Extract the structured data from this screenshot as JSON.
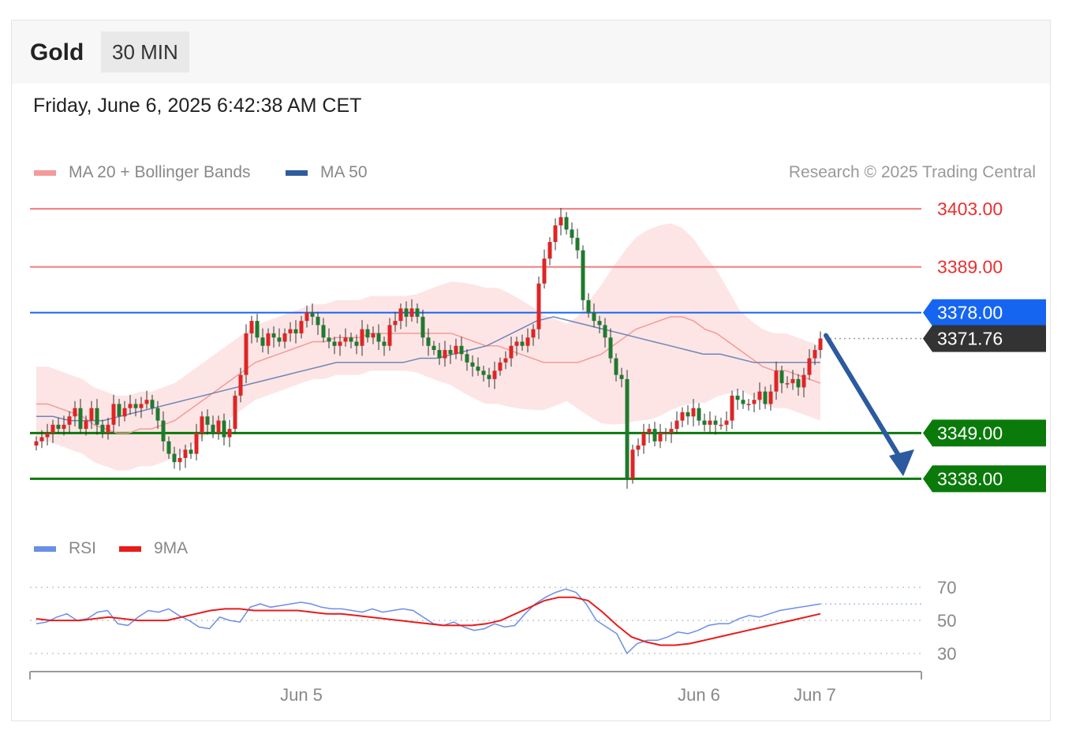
{
  "header": {
    "asset": "Gold",
    "timeframe": "30 MIN"
  },
  "timestamp": "Friday, June 6, 2025 6:42:38 AM CET",
  "legend_main": [
    {
      "label": "MA 20 + Bollinger Bands",
      "color": "#f59a9a"
    },
    {
      "label": "MA 50",
      "color": "#2f5c9e"
    }
  ],
  "legend_rsi": [
    {
      "label": "RSI",
      "color": "#6b8ee8"
    },
    {
      "label": "9MA",
      "color": "#e81b1b"
    }
  ],
  "credit": "Research © 2025 Trading Central",
  "colors": {
    "resistance": "#f07a7a",
    "pivot": "#1565f0",
    "support": "#0a7a0a",
    "last": "#333333",
    "arrow": "#2c5aa0",
    "band": "#fde0e0",
    "bull": "#e02424",
    "bear": "#1f7a2e"
  },
  "chart_data": [
    {
      "type": "candlestick",
      "title": "Gold",
      "timeframe": "30 MIN",
      "ylim": [
        3328,
        3410
      ],
      "levels": [
        {
          "value": 3403.0,
          "label": "3403.00",
          "kind": "resistance"
        },
        {
          "value": 3389.0,
          "label": "3389.00",
          "kind": "resistance"
        },
        {
          "value": 3378.0,
          "label": "3378.00",
          "kind": "pivot"
        },
        {
          "value": 3371.76,
          "label": "3371.76",
          "kind": "last"
        },
        {
          "value": 3349.0,
          "label": "3349.00",
          "kind": "support"
        },
        {
          "value": 3338.0,
          "label": "3338.00",
          "kind": "support"
        }
      ],
      "x_ticks": [
        "Jun 5",
        "Jun 6",
        "Jun 7"
      ],
      "x_tick_index": [
        48,
        120,
        141
      ],
      "forecast_arrow": {
        "from_index": 143,
        "from_value": 3372.5,
        "to_index": 157,
        "to_value": 3338.6
      },
      "series": [
        {
          "kind": "close",
          "values": [
            3347,
            3348,
            3349,
            3351,
            3350,
            3351,
            3353,
            3355,
            3350,
            3352,
            3355,
            3351,
            3349,
            3351,
            3356,
            3353,
            3355,
            3356,
            3355,
            3356,
            3357,
            3355,
            3352,
            3347,
            3344,
            3342,
            3343,
            3345,
            3344,
            3349,
            3353,
            3351,
            3349,
            3352,
            3348,
            3350,
            3358,
            3363,
            3373,
            3376,
            3372,
            3370,
            3373,
            3372,
            3371,
            3373,
            3374,
            3373,
            3376,
            3378,
            3377,
            3375,
            3372,
            3371,
            3370,
            3371,
            3372,
            3371,
            3370,
            3374,
            3372,
            3373,
            3371,
            3370,
            3375,
            3376,
            3379,
            3377,
            3379,
            3377,
            3372,
            3370,
            3369,
            3367,
            3369,
            3368,
            3370,
            3368,
            3366,
            3365,
            3364,
            3363,
            3362,
            3364,
            3366,
            3367,
            3370,
            3371,
            3370,
            3372,
            3374,
            3385,
            3391,
            3395,
            3399,
            3401,
            3398,
            3396,
            3393,
            3381,
            3378,
            3376,
            3375,
            3372,
            3367,
            3363,
            3362,
            3338,
            3345,
            3346,
            3349,
            3350,
            3347,
            3349,
            3349,
            3350,
            3352,
            3354,
            3353,
            3355,
            3352,
            3351,
            3352,
            3351,
            3351,
            3352,
            3358,
            3357,
            3356,
            3356,
            3357,
            3359,
            3356,
            3359,
            3364,
            3361,
            3361,
            3362,
            3360,
            3363,
            3367,
            3369,
            3371.76
          ]
        },
        {
          "kind": "ma20",
          "values": [
            3356,
            3356,
            3355,
            3354,
            3353,
            3351,
            3350,
            3349,
            3349,
            3350,
            3350,
            3351,
            3352,
            3354,
            3356,
            3358,
            3360,
            3362,
            3364,
            3366,
            3367,
            3368,
            3369,
            3370,
            3371,
            3371,
            3372,
            3372,
            3372,
            3373,
            3373,
            3373,
            3373,
            3373,
            3373,
            3373,
            3373,
            3372,
            3371,
            3370,
            3370,
            3369,
            3368,
            3367,
            3366,
            3366,
            3366,
            3366,
            3367,
            3368,
            3370,
            3372,
            3374,
            3375,
            3376,
            3377,
            3377,
            3376,
            3374,
            3373,
            3371,
            3369,
            3367,
            3365,
            3364,
            3364,
            3363,
            3362,
            3361
          ]
        },
        {
          "kind": "ma50",
          "values": [
            3353,
            3353,
            3352,
            3352,
            3352,
            3353,
            3354,
            3355,
            3356,
            3357,
            3358,
            3359,
            3360,
            3361,
            3362,
            3363,
            3364,
            3365,
            3366,
            3366,
            3366,
            3366,
            3366,
            3367,
            3367,
            3368,
            3369,
            3370,
            3372,
            3374,
            3376,
            3377,
            3376,
            3375,
            3374,
            3373,
            3372,
            3371,
            3370,
            3369,
            3368,
            3368,
            3367,
            3366,
            3366,
            3366,
            3366,
            3366
          ]
        },
        {
          "kind": "rsi",
          "values": [
            48,
            49,
            52,
            54,
            50,
            51,
            55,
            56,
            48,
            47,
            52,
            56,
            55,
            57,
            53,
            50,
            46,
            45,
            52,
            50,
            49,
            58,
            60,
            58,
            59,
            60,
            61,
            60,
            58,
            57,
            57,
            56,
            55,
            57,
            55,
            56,
            57,
            56,
            52,
            48,
            47,
            49,
            46,
            44,
            45,
            48,
            46,
            47,
            54,
            60,
            64,
            67,
            69,
            67,
            60,
            50,
            46,
            42,
            30,
            36,
            38,
            38,
            40,
            43,
            42,
            44,
            47,
            48,
            48,
            51,
            53,
            52,
            54,
            56,
            57,
            58,
            59,
            60
          ]
        },
        {
          "kind": "rsi_9ma",
          "values": [
            51,
            50,
            50,
            50,
            51,
            52,
            51,
            50,
            50,
            50,
            52,
            54,
            56,
            57,
            57,
            56,
            56,
            56,
            56,
            55,
            54,
            54,
            53,
            52,
            51,
            50,
            49,
            48,
            47,
            47,
            47,
            48,
            50,
            54,
            58,
            62,
            64,
            64,
            62,
            55,
            47,
            40,
            37,
            35,
            35,
            36,
            38,
            40,
            42,
            44,
            46,
            48,
            50,
            52,
            54
          ]
        }
      ],
      "rsi_axis": {
        "ticks": [
          "70",
          "50",
          "30"
        ],
        "levels": [
          70,
          50,
          30
        ],
        "ylim": [
          20,
          82
        ]
      }
    }
  ]
}
